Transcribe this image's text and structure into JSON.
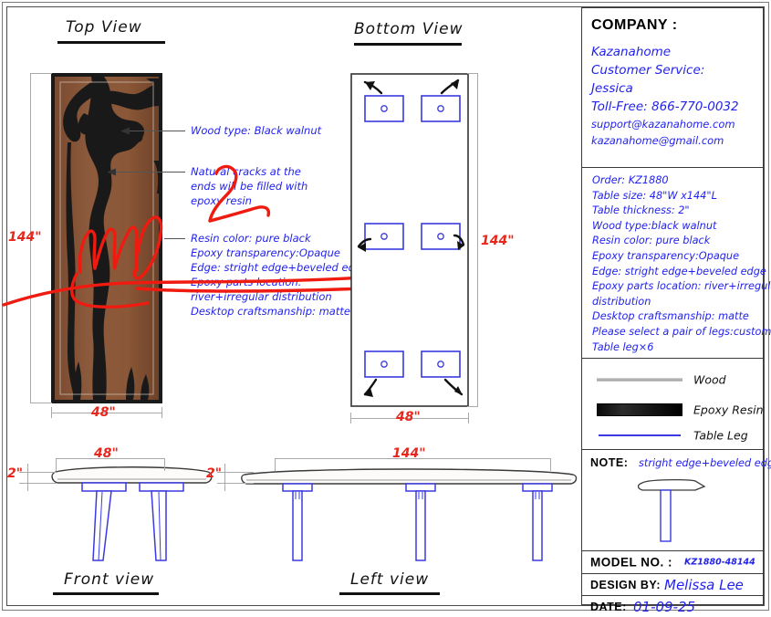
{
  "sheet": {
    "views": {
      "top": {
        "title": "Top View"
      },
      "bottom": {
        "title": "Bottom View"
      },
      "front": {
        "title": "Front view"
      },
      "left": {
        "title": "Left view"
      }
    },
    "dimensions": {
      "top_length": "144\"",
      "top_width": "48\"",
      "bottom_length": "144\"",
      "bottom_width": "48\"",
      "front_width": "48\"",
      "front_thickness": "2\"",
      "left_length": "144\"",
      "left_thickness": "2\""
    },
    "annotations": {
      "wood_type": "Wood type: Black walnut",
      "cracks_l1": "Natural cracks at the",
      "cracks_l2": "ends will be filled with",
      "cracks_l3": "epoxy resin",
      "spec_l1": "Resin color: pure black",
      "spec_l2": "Epoxy transparency:Opaque",
      "spec_l3": "Edge: stright edge+beveled edge",
      "spec_l4": "Epoxy parts location:",
      "spec_l5": " river+irregular distribution",
      "spec_l6": "Desktop craftsmanship: matte"
    }
  },
  "panel": {
    "company_label": "COMPANY :",
    "company": {
      "name": "Kazanahome",
      "service_line": "Customer Service:",
      "rep": "Jessica",
      "toll_free": "Toll-Free: 866-770-0032",
      "email_support": "support@kazanahome.com",
      "email_gmail": "kazanahome@gmail.com"
    },
    "specs": [
      "Order: KZ1880",
      "Table size: 48\"W x144\"L",
      "Table thickness: 2\"",
      "Wood type:black walnut",
      "Resin color: pure black",
      "Epoxy transparency:Opaque",
      "Edge: stright edge+beveled edge",
      "Epoxy parts location: river+irregular",
      "distribution",
      "Desktop craftsmanship: matte",
      "Please select a pair of legs:custom",
      "Table leg×6"
    ],
    "legend": [
      {
        "label": "Wood",
        "swatch": "wood-line-swatch"
      },
      {
        "label": "Epoxy Resin",
        "swatch": "epoxy-block-swatch"
      },
      {
        "label": "Table Leg",
        "swatch": "leg-line-swatch"
      }
    ],
    "note": {
      "label": "NOTE:",
      "text": "stright edge+beveled edge"
    },
    "titleblock": {
      "model_label": "MODEL  NO. :",
      "model_value": "KZ1880-48144",
      "design_label": "DESIGN BY:",
      "design_value": "Melissa Lee",
      "date_label": "DATE:",
      "date_value": "01-09-25"
    }
  },
  "colors": {
    "annotation_blue": "#2222ee",
    "dimension_red": "#e8261c",
    "leg_blue": "#3a3ae0",
    "wood_brown": "#8b5a3c",
    "epoxy_black": "#141414"
  }
}
